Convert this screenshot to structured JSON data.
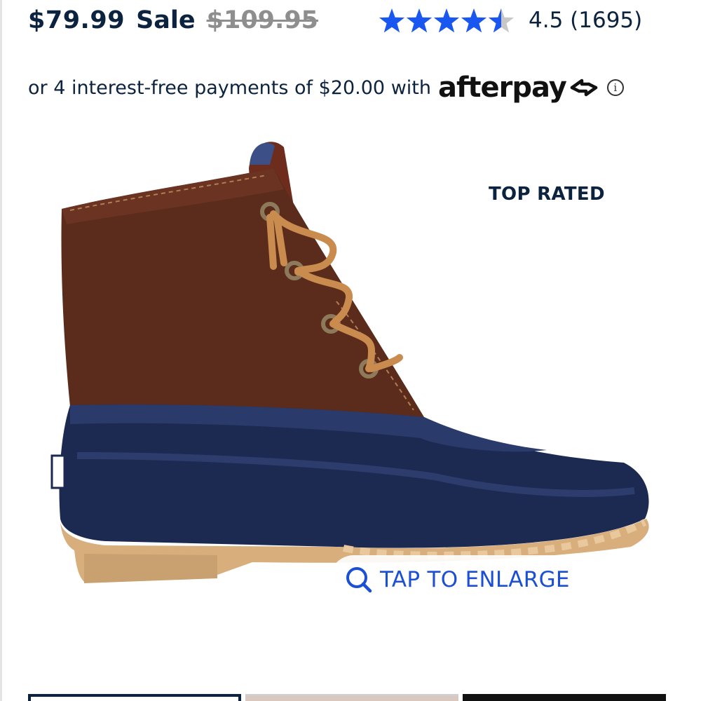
{
  "price": {
    "sale_price": "$79.99",
    "sale_label": "Sale",
    "original_price": "$109.95"
  },
  "rating": {
    "value": 4.5,
    "max": 5,
    "text": "4.5 (1695)",
    "star_color": "#1a56f0",
    "empty_star_color": "#c7c7c7"
  },
  "afterpay": {
    "text": "or 4 interest-free payments of $20.00 with",
    "logo_text": "afterpay",
    "info_icon": "info-icon"
  },
  "product": {
    "badge": "TOP RATED",
    "image_icon": "duck-boot-image",
    "enlarge_label": "TAP TO ENLARGE",
    "enlarge_icon": "magnifier-icon"
  },
  "colors": {
    "navy": "#0c2340",
    "link_blue": "#1a4fd6"
  }
}
